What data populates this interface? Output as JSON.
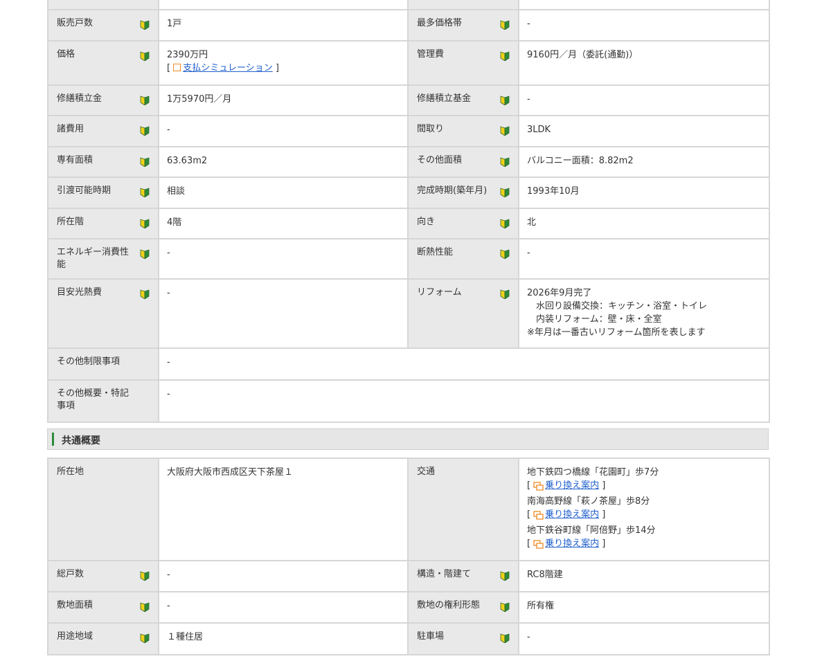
{
  "table1": {
    "rows": [
      {
        "l1": "販売戸数",
        "v1": "1戸",
        "l2": "最多価格帯",
        "v2": "-"
      },
      {
        "l1": "価格",
        "v1": "2390万円",
        "link": "支払シミュレーション",
        "l2": "管理費",
        "v2": "9160円／月（委託(通勤)）"
      },
      {
        "l1": "修繕積立金",
        "v1": "1万5970円／月",
        "l2": "修繕積立基金",
        "v2": "-"
      },
      {
        "l1": "諸費用",
        "v1": "-",
        "l2": "間取り",
        "v2": "3LDK"
      },
      {
        "l1": "専有面積",
        "v1": "63.63m2",
        "l2": "その他面積",
        "v2": "バルコニー面積：8.82m2"
      },
      {
        "l1": "引渡可能時期",
        "v1": "相談",
        "l2": "完成時期(築年月)",
        "v2": "1993年10月"
      },
      {
        "l1": "所在階",
        "v1": "4階",
        "l2": "向き",
        "v2": "北"
      },
      {
        "l1": "エネルギー消費性能",
        "v1": "-",
        "l2": "断熱性能",
        "v2": "-"
      },
      {
        "l1": "目安光熱費",
        "v1": "-",
        "l2": "リフォーム",
        "reform": [
          "2026年9月完了",
          "水回り設備交換：キッチン・浴室・トイレ",
          "内装リフォーム：壁・床・全室",
          "※年月は一番古いリフォーム箇所を表します"
        ]
      },
      {
        "l1": "その他制限事項",
        "v1": "-"
      },
      {
        "l1": "その他概要・特記事項",
        "v1": "-"
      }
    ]
  },
  "section": {
    "title": "共通概要"
  },
  "table2": {
    "location": {
      "label": "所在地",
      "value": "大阪府大阪市西成区天下茶屋１"
    },
    "transport": {
      "label": "交通",
      "routes": [
        {
          "text": "地下鉄四つ橋線「花園町」歩7分",
          "link": "乗り換え案内"
        },
        {
          "text": "南海高野線「萩ノ茶屋」歩8分",
          "link": "乗り換え案内"
        },
        {
          "text": "地下鉄谷町線「阿倍野」歩14分",
          "link": "乗り換え案内"
        }
      ]
    },
    "rows": [
      {
        "l1": "総戸数",
        "v1": "-",
        "l2": "構造・階建て",
        "v2": "RC8階建"
      },
      {
        "l1": "敷地面積",
        "v1": "-",
        "l2": "敷地の権利形態",
        "v2": "所有権"
      },
      {
        "l1": "用途地域",
        "v1": "１種住居",
        "l2": "駐車場",
        "v2": "-"
      }
    ]
  },
  "bracket_open": "[",
  "bracket_close": "]",
  "colors": {
    "accent": "#2d8a3a",
    "link": "#1f5fcc",
    "label_bg": "#e9e9e9",
    "border": "#d6d6d6",
    "transfer_icon": "#f08a24"
  },
  "icons": {
    "beginner": "beginner-mark-icon",
    "transfer": "transfer-icon",
    "simulation": "checkbox-icon"
  }
}
